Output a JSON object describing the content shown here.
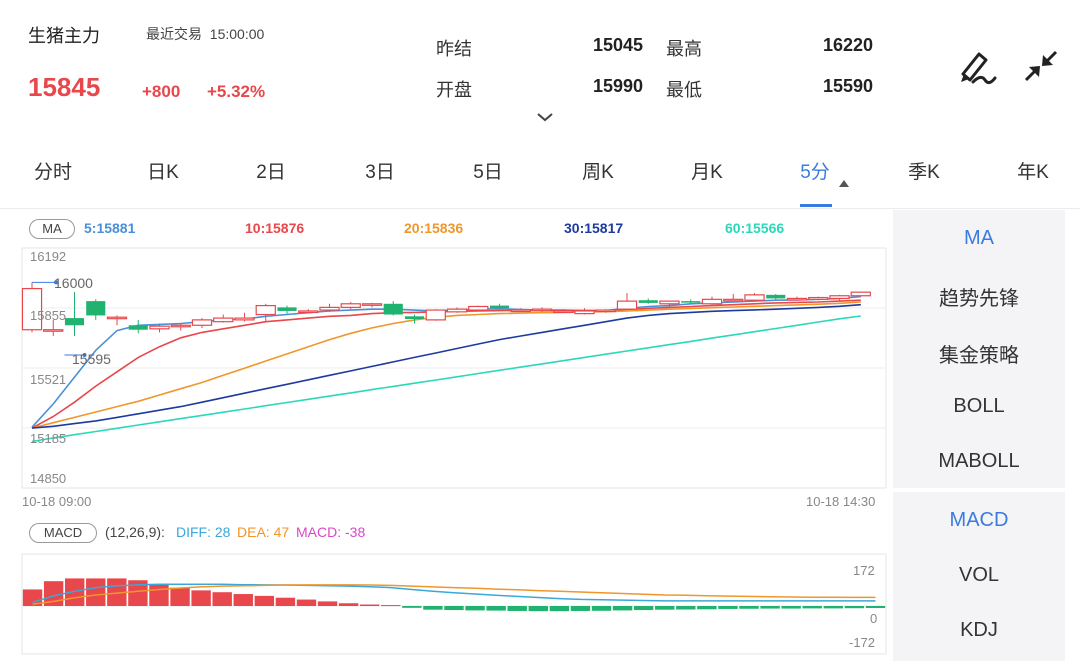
{
  "header": {
    "name": "生猪主力",
    "recent_label": "最近交易",
    "time": "15:00:00",
    "price": "15845",
    "change": "+800",
    "change_pct": "+5.32%",
    "quotes": [
      {
        "label": "昨结",
        "value": "15045"
      },
      {
        "label": "最高",
        "value": "16220"
      },
      {
        "label": "开盘",
        "value": "15990"
      },
      {
        "label": "最低",
        "value": "15590"
      }
    ]
  },
  "tabs": [
    "分时",
    "日K",
    "2日",
    "3日",
    "5日",
    "周K",
    "月K",
    "5分",
    "季K",
    "年K"
  ],
  "active_tab": "5分",
  "ma_legend": {
    "pill": "MA",
    "items": [
      {
        "text": "5:15881",
        "color": "#4a90d9"
      },
      {
        "text": "10:15876",
        "color": "#e8474b"
      },
      {
        "text": "20:15836",
        "color": "#f0962b"
      },
      {
        "text": "30:15817",
        "color": "#1e3a9e"
      },
      {
        "text": "60:15566",
        "color": "#2bd8b8"
      }
    ]
  },
  "main_axis": {
    "y_ticks": [
      "16192",
      "15855",
      "15521",
      "15185",
      "14850"
    ],
    "x_start": "10-18 09:00",
    "x_end": "10-18 14:30",
    "high_mark": "16000",
    "low_mark": "15595"
  },
  "macd_legend": {
    "pill": "MACD",
    "params": "(12,26,9):",
    "diff": "DIFF: 28",
    "dea": "DEA: 47",
    "macd": "MACD: -38",
    "y_ticks": [
      "172",
      "0",
      "-172"
    ]
  },
  "side_panel": {
    "top_items": [
      "MA",
      "趋势先锋",
      "集金策略",
      "BOLL",
      "MABOLL"
    ],
    "bottom_items": [
      "MACD",
      "VOL",
      "KDJ"
    ],
    "active_top": "MA",
    "active_bottom": "MACD"
  },
  "colors": {
    "up": "#e8474b",
    "down": "#1fb36f",
    "accent": "#3b7be0"
  },
  "chart_data": [
    {
      "type": "candlestick",
      "title": "5分",
      "ylim": [
        14850,
        16192
      ],
      "y_ticks": [
        16192,
        15855,
        15521,
        15185,
        14850
      ],
      "x_range": [
        "10-18 09:00",
        "10-18 14:30"
      ],
      "candles": [
        {
          "o": 15735,
          "h": 16000,
          "l": 15720,
          "c": 15965
        },
        {
          "o": 15735,
          "h": 15790,
          "l": 15700,
          "c": 15735
        },
        {
          "o": 15800,
          "h": 15945,
          "l": 15700,
          "c": 15760
        },
        {
          "o": 15895,
          "h": 15905,
          "l": 15790,
          "c": 15815
        },
        {
          "o": 15805,
          "h": 15815,
          "l": 15760,
          "c": 15805
        },
        {
          "o": 15760,
          "h": 15790,
          "l": 15715,
          "c": 15735
        },
        {
          "o": 15740,
          "h": 15770,
          "l": 15720,
          "c": 15755
        },
        {
          "o": 15755,
          "h": 15770,
          "l": 15730,
          "c": 15760
        },
        {
          "o": 15760,
          "h": 15800,
          "l": 15745,
          "c": 15790
        },
        {
          "o": 15780,
          "h": 15820,
          "l": 15775,
          "c": 15800
        },
        {
          "o": 15790,
          "h": 15830,
          "l": 15780,
          "c": 15800
        },
        {
          "o": 15820,
          "h": 15880,
          "l": 15780,
          "c": 15870
        },
        {
          "o": 15860,
          "h": 15870,
          "l": 15825,
          "c": 15840
        },
        {
          "o": 15835,
          "h": 15850,
          "l": 15830,
          "c": 15840
        },
        {
          "o": 15845,
          "h": 15880,
          "l": 15835,
          "c": 15860
        },
        {
          "o": 15860,
          "h": 15890,
          "l": 15850,
          "c": 15880
        },
        {
          "o": 15875,
          "h": 15885,
          "l": 15860,
          "c": 15880
        },
        {
          "o": 15880,
          "h": 15895,
          "l": 15815,
          "c": 15820
        },
        {
          "o": 15810,
          "h": 15820,
          "l": 15770,
          "c": 15795
        },
        {
          "o": 15790,
          "h": 15850,
          "l": 15785,
          "c": 15845
        },
        {
          "o": 15835,
          "h": 15860,
          "l": 15830,
          "c": 15850
        },
        {
          "o": 15845,
          "h": 15870,
          "l": 15840,
          "c": 15865
        },
        {
          "o": 15870,
          "h": 15880,
          "l": 15855,
          "c": 15855
        },
        {
          "o": 15845,
          "h": 15855,
          "l": 15835,
          "c": 15845
        },
        {
          "o": 15845,
          "h": 15860,
          "l": 15835,
          "c": 15850
        },
        {
          "o": 15840,
          "h": 15850,
          "l": 15830,
          "c": 15840
        },
        {
          "o": 15825,
          "h": 15855,
          "l": 15820,
          "c": 15840
        },
        {
          "o": 15845,
          "h": 15850,
          "l": 15830,
          "c": 15845
        },
        {
          "o": 15850,
          "h": 15940,
          "l": 15845,
          "c": 15895
        },
        {
          "o": 15900,
          "h": 15910,
          "l": 15880,
          "c": 15885
        },
        {
          "o": 15880,
          "h": 15890,
          "l": 15865,
          "c": 15895
        },
        {
          "o": 15895,
          "h": 15905,
          "l": 15880,
          "c": 15890
        },
        {
          "o": 15880,
          "h": 15920,
          "l": 15875,
          "c": 15905
        },
        {
          "o": 15905,
          "h": 15935,
          "l": 15895,
          "c": 15905
        },
        {
          "o": 15900,
          "h": 15940,
          "l": 15895,
          "c": 15930
        },
        {
          "o": 15930,
          "h": 15935,
          "l": 15900,
          "c": 15910
        },
        {
          "o": 15910,
          "h": 15920,
          "l": 15900,
          "c": 15910
        },
        {
          "o": 15905,
          "h": 15920,
          "l": 15900,
          "c": 15915
        },
        {
          "o": 15910,
          "h": 15930,
          "l": 15900,
          "c": 15925
        },
        {
          "o": 15925,
          "h": 15945,
          "l": 15920,
          "c": 15945
        }
      ],
      "series": [
        {
          "name": "MA5",
          "values": [
            15190,
            15320,
            15470,
            15620,
            15730,
            15760,
            15765,
            15770,
            15780,
            15790,
            15795,
            15810,
            15820,
            15830,
            15840,
            15845,
            15850,
            15850,
            15845,
            15840,
            15845,
            15850,
            15852,
            15848,
            15845,
            15845,
            15842,
            15843,
            15855,
            15865,
            15870,
            15880,
            15885,
            15890,
            15895,
            15900,
            15902,
            15905,
            15910,
            15920
          ]
        },
        {
          "name": "MA10",
          "values": [
            15185,
            15250,
            15330,
            15420,
            15500,
            15580,
            15640,
            15690,
            15720,
            15740,
            15760,
            15780,
            15790,
            15800,
            15810,
            15815,
            15825,
            15830,
            15832,
            15835,
            15838,
            15840,
            15842,
            15843,
            15842,
            15842,
            15842,
            15843,
            15848,
            15855,
            15860,
            15865,
            15870,
            15875,
            15880,
            15885,
            15888,
            15890,
            15895,
            15900
          ]
        },
        {
          "name": "MA20",
          "values": [
            15185,
            15215,
            15245,
            15275,
            15305,
            15335,
            15370,
            15405,
            15440,
            15480,
            15520,
            15560,
            15600,
            15640,
            15680,
            15715,
            15745,
            15770,
            15790,
            15805,
            15815,
            15820,
            15825,
            15828,
            15830,
            15832,
            15834,
            15836,
            15840,
            15845,
            15850,
            15854,
            15858,
            15862,
            15866,
            15870,
            15874,
            15878,
            15883,
            15890
          ]
        },
        {
          "name": "MA30",
          "values": [
            15185,
            15195,
            15210,
            15225,
            15245,
            15265,
            15285,
            15305,
            15330,
            15355,
            15380,
            15405,
            15430,
            15455,
            15480,
            15505,
            15530,
            15555,
            15580,
            15605,
            15630,
            15655,
            15680,
            15700,
            15720,
            15740,
            15760,
            15780,
            15800,
            15815,
            15825,
            15832,
            15838,
            15842,
            15846,
            15850,
            15855,
            15860,
            15866,
            15875
          ]
        },
        {
          "name": "MA60",
          "values": [
            15110,
            15130,
            15148,
            15166,
            15184,
            15202,
            15220,
            15238,
            15256,
            15274,
            15292,
            15310,
            15328,
            15346,
            15364,
            15382,
            15400,
            15418,
            15436,
            15454,
            15472,
            15490,
            15508,
            15526,
            15544,
            15562,
            15580,
            15598,
            15616,
            15634,
            15652,
            15670,
            15688,
            15706,
            15724,
            15742,
            15760,
            15778,
            15796,
            15812
          ]
        }
      ]
    },
    {
      "type": "bar",
      "title": "MACD (12,26,9)",
      "ylim": [
        -172,
        172
      ],
      "y_ticks": [
        172,
        0,
        -172
      ],
      "bars": [
        90,
        135,
        150,
        150,
        150,
        140,
        120,
        100,
        85,
        75,
        65,
        55,
        45,
        35,
        25,
        15,
        8,
        5,
        -10,
        -20,
        -22,
        -24,
        -25,
        -27,
        -28,
        -28,
        -27,
        -26,
        -24,
        -22,
        -20,
        -19,
        -18,
        -16,
        -15,
        -14,
        -14,
        -13,
        -13,
        -12,
        -11
      ],
      "series": [
        {
          "name": "DIFF",
          "values": [
            20,
            55,
            80,
            100,
            110,
            115,
            118,
            118,
            118,
            118,
            116,
            115,
            114,
            112,
            110,
            108,
            105,
            100,
            90,
            80,
            72,
            65,
            58,
            52,
            46,
            40,
            36,
            34,
            32,
            30,
            28,
            28,
            28,
            28,
            28,
            28,
            28,
            28,
            28,
            28,
            28
          ]
        },
        {
          "name": "DEA",
          "values": [
            10,
            25,
            45,
            60,
            70,
            80,
            90,
            98,
            104,
            108,
            110,
            112,
            114,
            115,
            115,
            115,
            114,
            112,
            108,
            104,
            100,
            96,
            92,
            88,
            84,
            80,
            76,
            72,
            68,
            64,
            60,
            58,
            56,
            54,
            52,
            50,
            49,
            48,
            48,
            47,
            47
          ]
        }
      ]
    }
  ]
}
